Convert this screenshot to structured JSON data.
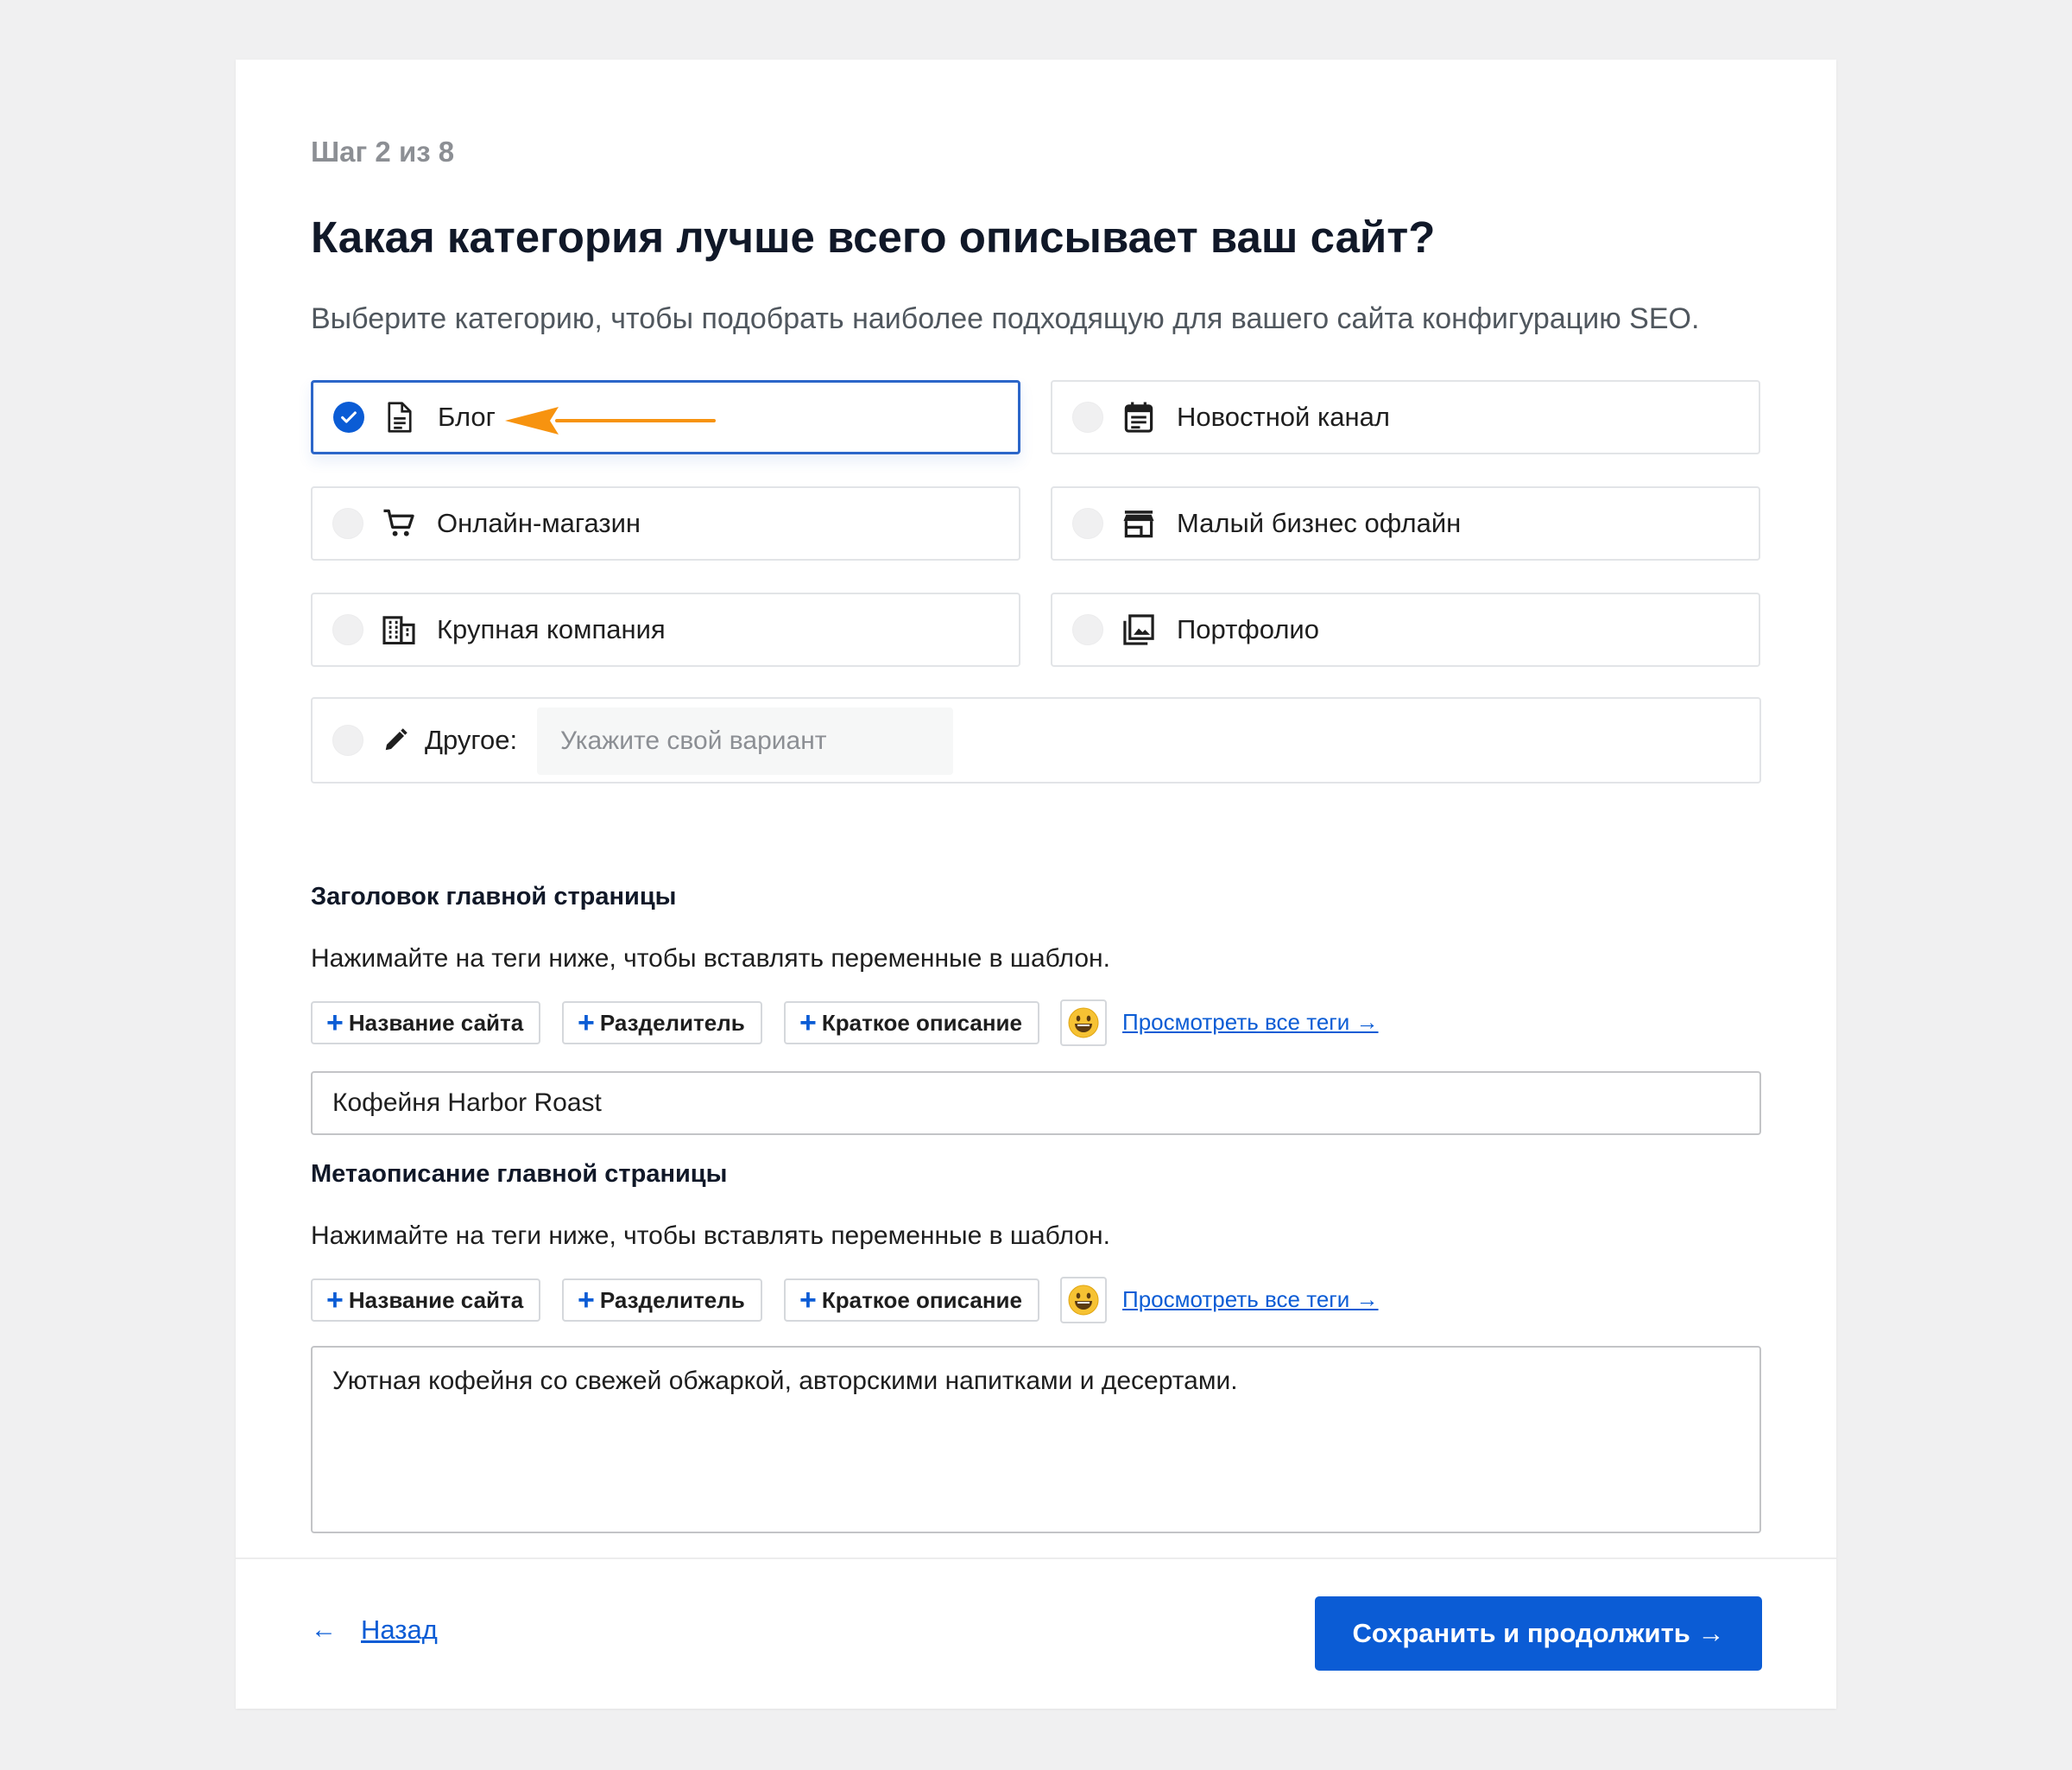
{
  "step": "Шаг 2 из 8",
  "title": "Какая категория лучше всего описывает ваш сайт?",
  "subtitle": "Выберите категорию, чтобы подобрать наиболее подходящую для вашего сайта конфигурацию SEO.",
  "categories": [
    {
      "label": "Блог",
      "icon": "document-icon",
      "selected": true
    },
    {
      "label": "Новостной канал",
      "icon": "calendar-icon",
      "selected": false
    },
    {
      "label": "Онлайн-магазин",
      "icon": "cart-icon",
      "selected": false
    },
    {
      "label": "Малый бизнес офлайн",
      "icon": "store-icon",
      "selected": false
    },
    {
      "label": "Крупная компания",
      "icon": "building-icon",
      "selected": false
    },
    {
      "label": "Портфолио",
      "icon": "gallery-icon",
      "selected": false
    }
  ],
  "other": {
    "label": "Другое:",
    "placeholder": "Укажите свой вариант",
    "icon": "pencil-icon"
  },
  "homepage_title": {
    "heading": "Заголовок главной страницы",
    "hint": "Нажимайте на теги ниже, чтобы вставлять переменные в шаблон.",
    "tags": [
      "Название сайта",
      "Разделитель",
      "Краткое описание"
    ],
    "view_all": "Просмотреть все теги →",
    "value": "Кофейня Harbor Roast"
  },
  "homepage_meta": {
    "heading": "Метаописание главной страницы",
    "hint": "Нажимайте на теги ниже, чтобы вставлять переменные в шаблон.",
    "tags": [
      "Название сайта",
      "Разделитель",
      "Краткое описание"
    ],
    "view_all": "Просмотреть все теги →",
    "value": "Уютная кофейня со свежей обжаркой, авторскими напитками и десертами."
  },
  "footer": {
    "back_arrow": "←",
    "back_label": "Назад",
    "continue_label": "Сохранить и продолжить →"
  },
  "colors": {
    "accent": "#0b5cd5",
    "annotation_arrow": "#f7930f",
    "background": "#f0f0f1"
  }
}
